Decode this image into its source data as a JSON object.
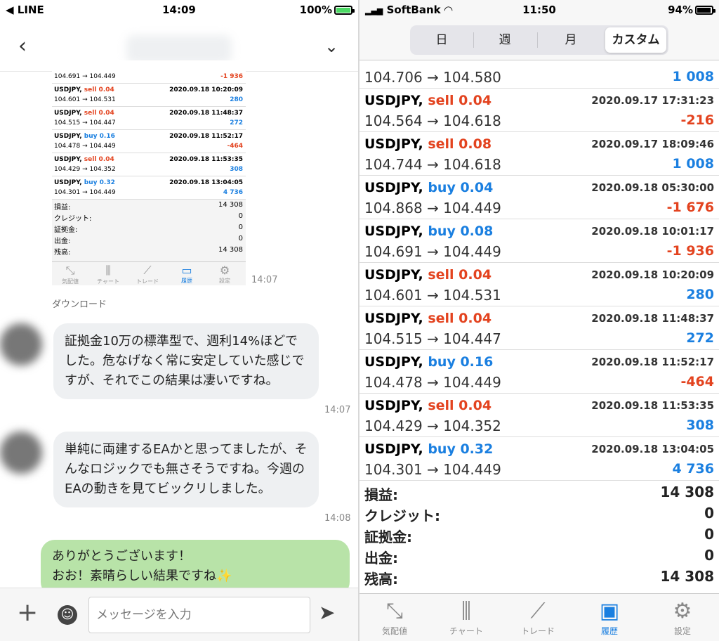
{
  "left": {
    "status": {
      "carrier": "◀ LINE",
      "time": "14:09",
      "battery": "100%"
    },
    "shot": {
      "rows": [
        {
          "sym": "",
          "date": "",
          "price": "104.691 → 104.449",
          "profit": "-1 936",
          "side": ""
        },
        {
          "sym": "USDJPY, ",
          "side": "sell 0.04",
          "date": "2020.09.18 10:20:09",
          "price": "104.601 → 104.531",
          "profit": "280"
        },
        {
          "sym": "USDJPY, ",
          "side": "sell 0.04",
          "date": "2020.09.18 11:48:37",
          "price": "104.515 → 104.447",
          "profit": "272"
        },
        {
          "sym": "USDJPY, ",
          "side": "buy 0.16",
          "date": "2020.09.18 11:52:17",
          "price": "104.478 → 104.449",
          "profit": "-464"
        },
        {
          "sym": "USDJPY, ",
          "side": "sell 0.04",
          "date": "2020.09.18 11:53:35",
          "price": "104.429 → 104.352",
          "profit": "308"
        },
        {
          "sym": "USDJPY, ",
          "side": "buy 0.32",
          "date": "2020.09.18 13:04:05",
          "price": "104.301 → 104.449",
          "profit": "4 736"
        }
      ],
      "summary": [
        {
          "k": "損益:",
          "v": "14 308"
        },
        {
          "k": "クレジット:",
          "v": "0"
        },
        {
          "k": "証拠金:",
          "v": "0"
        },
        {
          "k": "出金:",
          "v": "0"
        },
        {
          "k": "残高:",
          "v": "14 308"
        }
      ],
      "tabs": [
        "気配値",
        "チャート",
        "トレード",
        "履歴",
        "設定"
      ],
      "time": "14:07"
    },
    "download": "ダウンロード",
    "msg1": "証拠金10万の標準型で、週利14%ほどでした。危なげなく常に安定していた感じですが、それでこの結果は凄いですね。",
    "msg1_time": "14:07",
    "msg2": "単純に両建するEAかと思ってましたが、そんなロジックでも無さそうですね。今週のEAの動きを見てビックリしました。",
    "msg2_time": "14:08",
    "msg3_line1": "ありがとうございます！",
    "msg3_line2": "おお！素晴らしい結果ですね✨",
    "input_placeholder": "メッセージを入力"
  },
  "right": {
    "status": {
      "carrier": "SoftBank",
      "time": "11:50",
      "battery": "94%"
    },
    "segments": [
      "日",
      "週",
      "月",
      "カスタム"
    ],
    "rows": [
      {
        "sym": "",
        "side": "",
        "date": "",
        "price": "104.706 → 104.580",
        "profit": "1 008",
        "neg": false
      },
      {
        "sym": "USDJPY, ",
        "side": "sell 0.04",
        "date": "2020.09.17 17:31:23",
        "price": "104.564 → 104.618",
        "profit": "-216",
        "neg": true
      },
      {
        "sym": "USDJPY, ",
        "side": "sell 0.08",
        "date": "2020.09.17 18:09:46",
        "price": "104.744 → 104.618",
        "profit": "1 008",
        "neg": false
      },
      {
        "sym": "USDJPY, ",
        "side": "buy 0.04",
        "date": "2020.09.18 05:30:00",
        "price": "104.868 → 104.449",
        "profit": "-1 676",
        "neg": true
      },
      {
        "sym": "USDJPY, ",
        "side": "buy 0.08",
        "date": "2020.09.18 10:01:17",
        "price": "104.691 → 104.449",
        "profit": "-1 936",
        "neg": true
      },
      {
        "sym": "USDJPY, ",
        "side": "sell 0.04",
        "date": "2020.09.18 10:20:09",
        "price": "104.601 → 104.531",
        "profit": "280",
        "neg": false
      },
      {
        "sym": "USDJPY, ",
        "side": "sell 0.04",
        "date": "2020.09.18 11:48:37",
        "price": "104.515 → 104.447",
        "profit": "272",
        "neg": false
      },
      {
        "sym": "USDJPY, ",
        "side": "buy 0.16",
        "date": "2020.09.18 11:52:17",
        "price": "104.478 → 104.449",
        "profit": "-464",
        "neg": true
      },
      {
        "sym": "USDJPY, ",
        "side": "sell 0.04",
        "date": "2020.09.18 11:53:35",
        "price": "104.429 → 104.352",
        "profit": "308",
        "neg": false
      },
      {
        "sym": "USDJPY, ",
        "side": "buy 0.32",
        "date": "2020.09.18 13:04:05",
        "price": "104.301 → 104.449",
        "profit": "4 736",
        "neg": false
      }
    ],
    "summary": [
      {
        "k": "損益:",
        "v": "14 308"
      },
      {
        "k": "クレジット:",
        "v": "0"
      },
      {
        "k": "証拠金:",
        "v": "0"
      },
      {
        "k": "出金:",
        "v": "0"
      },
      {
        "k": "残高:",
        "v": "14 308"
      }
    ],
    "tabs": [
      "気配値",
      "チャート",
      "トレード",
      "履歴",
      "設定"
    ],
    "colors": {
      "sell": "#e3431f",
      "buy": "#1a7fe0",
      "accent": "#1a7fe0",
      "chat_green": "#b8e3a8"
    }
  }
}
